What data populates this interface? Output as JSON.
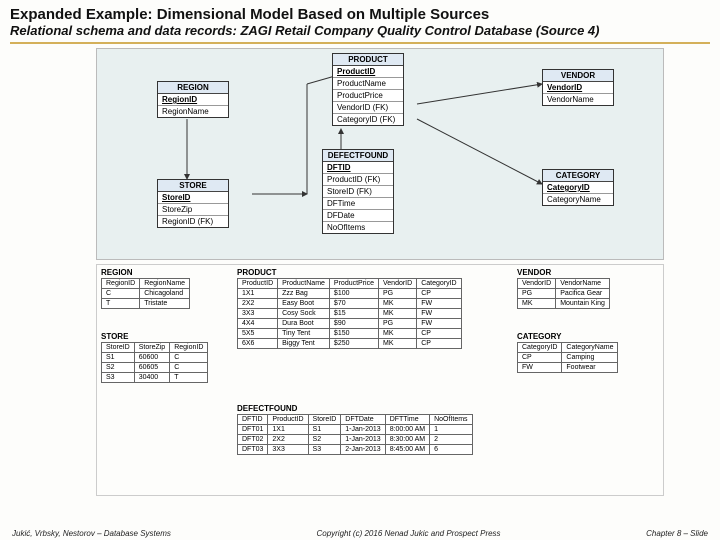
{
  "title": "Expanded Example: Dimensional Model Based on Multiple Sources",
  "subtitle": "Relational schema and data records: ZAGI Retail Company Quality Control Database (Source 4)",
  "entities": {
    "region": {
      "name": "REGION",
      "rows": [
        "RegionID",
        "RegionName"
      ]
    },
    "store": {
      "name": "STORE",
      "rows": [
        "StoreID",
        "StoreZip",
        "RegionID (FK)"
      ]
    },
    "product": {
      "name": "PRODUCT",
      "rows": [
        "ProductID",
        "ProductName",
        "ProductPrice",
        "VendorID (FK)",
        "CategoryID (FK)"
      ]
    },
    "defect": {
      "name": "DEFECTFOUND",
      "rows": [
        "DFTID",
        "ProductID (FK)",
        "StoreID (FK)",
        "DFTime",
        "DFDate",
        "NoOfItems"
      ]
    },
    "vendor": {
      "name": "VENDOR",
      "rows": [
        "VendorID",
        "VendorName"
      ]
    },
    "category": {
      "name": "CATEGORY",
      "rows": [
        "CategoryID",
        "CategoryName"
      ]
    }
  },
  "tables": {
    "region": {
      "name": "REGION",
      "headers": [
        "RegionID",
        "RegionName"
      ],
      "rows": [
        [
          "C",
          "Chicagoland"
        ],
        [
          "T",
          "Tristate"
        ]
      ]
    },
    "store": {
      "name": "STORE",
      "headers": [
        "StoreID",
        "StoreZip",
        "RegionID"
      ],
      "rows": [
        [
          "S1",
          "60600",
          "C"
        ],
        [
          "S2",
          "60605",
          "C"
        ],
        [
          "S3",
          "30400",
          "T"
        ]
      ]
    },
    "product": {
      "name": "PRODUCT",
      "headers": [
        "ProductID",
        "ProductName",
        "ProductPrice",
        "VendorID",
        "CategoryID"
      ],
      "rows": [
        [
          "1X1",
          "Zzz Bag",
          "$100",
          "PG",
          "CP"
        ],
        [
          "2X2",
          "Easy Boot",
          "$70",
          "MK",
          "FW"
        ],
        [
          "3X3",
          "Cosy Sock",
          "$15",
          "MK",
          "FW"
        ],
        [
          "4X4",
          "Dura Boot",
          "$90",
          "PG",
          "FW"
        ],
        [
          "5X5",
          "Tiny Tent",
          "$150",
          "MK",
          "CP"
        ],
        [
          "6X6",
          "Biggy Tent",
          "$250",
          "MK",
          "CP"
        ]
      ]
    },
    "vendor": {
      "name": "VENDOR",
      "headers": [
        "VendorID",
        "VendorName"
      ],
      "rows": [
        [
          "PG",
          "Pacifica Gear"
        ],
        [
          "MK",
          "Mountain King"
        ]
      ]
    },
    "category": {
      "name": "CATEGORY",
      "headers": [
        "CategoryID",
        "CategoryName"
      ],
      "rows": [
        [
          "CP",
          "Camping"
        ],
        [
          "FW",
          "Footwear"
        ]
      ]
    },
    "defect": {
      "name": "DEFECTFOUND",
      "headers": [
        "DFTID",
        "ProductID",
        "StoreID",
        "DFTDate",
        "DFTTime",
        "NoOfItems"
      ],
      "rows": [
        [
          "DFT01",
          "1X1",
          "S1",
          "1-Jan-2013",
          "8:00:00 AM",
          "1"
        ],
        [
          "DFT02",
          "2X2",
          "S2",
          "1-Jan-2013",
          "8:30:00 AM",
          "2"
        ],
        [
          "DFT03",
          "3X3",
          "S3",
          "2-Jan-2013",
          "8:45:00 AM",
          "6"
        ]
      ]
    }
  },
  "footer": {
    "left": "Jukić, Vrbsky, Nestorov – Database Systems",
    "center": "Copyright (c) 2016 Nenad Jukic and Prospect Press",
    "right": "Chapter 8 – Slide"
  }
}
